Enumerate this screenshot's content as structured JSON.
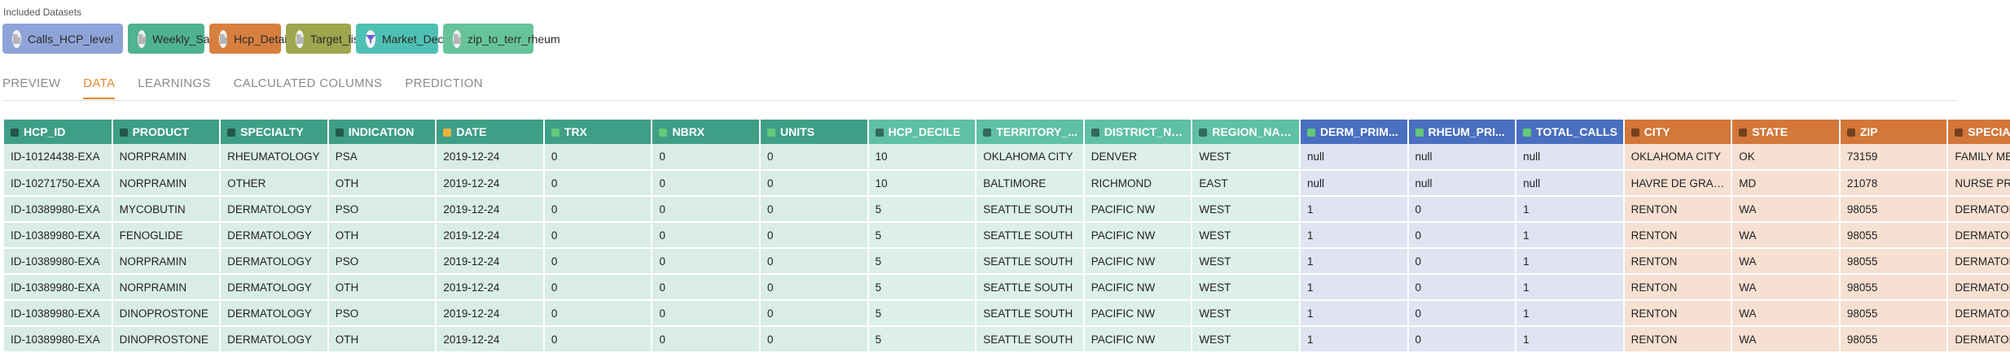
{
  "datasets": {
    "title": "Included Datasets",
    "chips": [
      {
        "label": "Calls_HCP_level",
        "color": "#8ea4d8",
        "icon": "file-icon"
      },
      {
        "label": "Weekly_Sales",
        "color": "#4fb290",
        "icon": "file-icon"
      },
      {
        "label": "Hcp_Details",
        "color": "#d77f3f",
        "icon": "file-icon"
      },
      {
        "label": "Target_list",
        "color": "#9ea64e",
        "icon": "file-icon"
      },
      {
        "label": "Market_Deciles",
        "color": "#4ec0b4",
        "icon": "funnel-icon"
      },
      {
        "label": "zip_to_terr_rheum",
        "color": "#67c49a",
        "icon": "file-icon"
      }
    ]
  },
  "tabs": [
    {
      "label": "PREVIEW",
      "active": false
    },
    {
      "label": "DATA",
      "active": true
    },
    {
      "label": "LEARNINGS",
      "active": false
    },
    {
      "label": "CALCULATED COLUMNS",
      "active": false
    },
    {
      "label": "PREDICTION",
      "active": false
    }
  ],
  "table": {
    "columns": [
      {
        "label": "HCP_ID",
        "group": "green",
        "icon": "grid"
      },
      {
        "label": "PRODUCT",
        "group": "green",
        "icon": "grid"
      },
      {
        "label": "SPECIALTY",
        "group": "green",
        "icon": "grid"
      },
      {
        "label": "INDICATION",
        "group": "green",
        "icon": "grid"
      },
      {
        "label": "DATE",
        "group": "green",
        "icon": "calendar"
      },
      {
        "label": "TRX",
        "group": "green",
        "icon": "check"
      },
      {
        "label": "NBRX",
        "group": "green",
        "icon": "check"
      },
      {
        "label": "UNITS",
        "group": "green",
        "icon": "check"
      },
      {
        "label": "HCP_DECILE",
        "group": "mint",
        "icon": "grid"
      },
      {
        "label": "TERRITORY_...",
        "group": "mint",
        "icon": "grid"
      },
      {
        "label": "DISTRICT_NA...",
        "group": "mint",
        "icon": "grid"
      },
      {
        "label": "REGION_NAME",
        "group": "mint",
        "icon": "grid"
      },
      {
        "label": "DERM_PRIM...",
        "group": "blue",
        "icon": "check"
      },
      {
        "label": "RHEUM_PRI...",
        "group": "blue",
        "icon": "check"
      },
      {
        "label": "TOTAL_CALLS",
        "group": "blue",
        "icon": "check"
      },
      {
        "label": "CITY",
        "group": "orange",
        "icon": "grid"
      },
      {
        "label": "STATE",
        "group": "orange",
        "icon": "grid"
      },
      {
        "label": "ZIP",
        "group": "orange",
        "icon": "grid"
      },
      {
        "label": "SPECIALIZAT...",
        "group": "orange",
        "icon": "grid"
      }
    ],
    "rows": [
      [
        "ID-10124438-EXA",
        "NORPRAMIN",
        "RHEUMATOLOGY",
        "PSA",
        "2019-12-24",
        "0",
        "0",
        "0",
        "10",
        "OKLAHOMA CITY",
        "DENVER",
        "WEST",
        "null",
        "null",
        "null",
        "OKLAHOMA CITY",
        "OK",
        "73159",
        "FAMILY MEDICINE"
      ],
      [
        "ID-10271750-EXA",
        "NORPRAMIN",
        "OTHER",
        "OTH",
        "2019-12-24",
        "0",
        "0",
        "0",
        "10",
        "BALTIMORE",
        "RICHMOND",
        "EAST",
        "null",
        "null",
        "null",
        "HAVRE DE GRACE",
        "MD",
        "21078",
        "NURSE PRACTITIONER"
      ],
      [
        "ID-10389980-EXA",
        "MYCOBUTIN",
        "DERMATOLOGY",
        "PSO",
        "2019-12-24",
        "0",
        "0",
        "0",
        "5",
        "SEATTLE SOUTH",
        "PACIFIC NW",
        "WEST",
        "1",
        "0",
        "1",
        "RENTON",
        "WA",
        "98055",
        "DERMATOLOGY NP"
      ],
      [
        "ID-10389980-EXA",
        "FENOGLIDE",
        "DERMATOLOGY",
        "OTH",
        "2019-12-24",
        "0",
        "0",
        "0",
        "5",
        "SEATTLE SOUTH",
        "PACIFIC NW",
        "WEST",
        "1",
        "0",
        "1",
        "RENTON",
        "WA",
        "98055",
        "DERMATOLOGY NP"
      ],
      [
        "ID-10389980-EXA",
        "NORPRAMIN",
        "DERMATOLOGY",
        "PSO",
        "2019-12-24",
        "0",
        "0",
        "0",
        "5",
        "SEATTLE SOUTH",
        "PACIFIC NW",
        "WEST",
        "1",
        "0",
        "1",
        "RENTON",
        "WA",
        "98055",
        "DERMATOLOGY NP"
      ],
      [
        "ID-10389980-EXA",
        "NORPRAMIN",
        "DERMATOLOGY",
        "OTH",
        "2019-12-24",
        "0",
        "0",
        "0",
        "5",
        "SEATTLE SOUTH",
        "PACIFIC NW",
        "WEST",
        "1",
        "0",
        "1",
        "RENTON",
        "WA",
        "98055",
        "DERMATOLOGY NP"
      ],
      [
        "ID-10389980-EXA",
        "DINOPROSTONE",
        "DERMATOLOGY",
        "PSO",
        "2019-12-24",
        "0",
        "0",
        "0",
        "5",
        "SEATTLE SOUTH",
        "PACIFIC NW",
        "WEST",
        "1",
        "0",
        "1",
        "RENTON",
        "WA",
        "98055",
        "DERMATOLOGY NP"
      ],
      [
        "ID-10389980-EXA",
        "DINOPROSTONE",
        "DERMATOLOGY",
        "OTH",
        "2019-12-24",
        "0",
        "0",
        "0",
        "5",
        "SEATTLE SOUTH",
        "PACIFIC NW",
        "WEST",
        "1",
        "0",
        "1",
        "RENTON",
        "WA",
        "98055",
        "DERMATOLOGY NP"
      ]
    ]
  }
}
